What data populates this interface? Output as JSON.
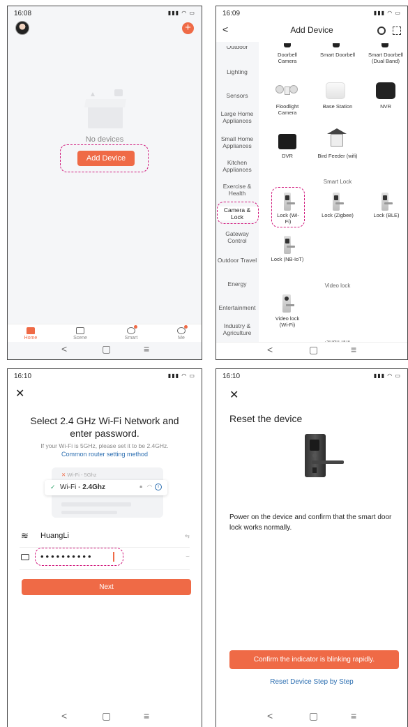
{
  "colors": {
    "accent": "#ef6a46",
    "link": "#2a6db0",
    "dash": "#d0147a"
  },
  "home": {
    "time": "16:08",
    "empty_text": "No devices",
    "add_device_label": "Add Device",
    "tabs": [
      {
        "label": "Home"
      },
      {
        "label": "Scene"
      },
      {
        "label": "Smart"
      },
      {
        "label": "Me"
      }
    ]
  },
  "add_device": {
    "time": "16:09",
    "title": "Add Device",
    "categories": [
      "Lighting",
      "Sensors",
      "Large Home Appliances",
      "Small Home Appliances",
      "Kitchen Appliances",
      "Exercise & Health",
      "Camera & Lock",
      "Gateway Control",
      "Outdoor Travel",
      "Energy",
      "Entertainment",
      "Industry & Agriculture"
    ],
    "top_cut_category": "Outdoor",
    "devices_row1": [
      "Doorbell Camera",
      "Smart Doorbell",
      "Smart Doorbell (Dual Band)"
    ],
    "devices_row2": [
      "Floodlight Camera",
      "Base Station",
      "NVR"
    ],
    "devices_row3": [
      "DVR",
      "Bird Feeder (wifi)"
    ],
    "section_smart_lock": "Smart Lock",
    "locks_row1": [
      "Lock (Wi-Fi)",
      "Lock (Zigbee)",
      "Lock (BLE)"
    ],
    "locks_row2": [
      "Lock (NB-IoT)"
    ],
    "section_video_lock": "Video lock",
    "video_locks": [
      "Video lock (Wi-Fi)"
    ],
    "section_smart_box": "Smart box"
  },
  "wifi": {
    "time": "16:10",
    "heading": "Select 2.4 GHz Wi-Fi Network and enter password.",
    "sub": "If your Wi-Fi is 5GHz, please set it to be 2.4GHz.",
    "link": "Common router setting method",
    "illus_5g": "Wi-Fi - 5Ghz",
    "illus_24_prefix": "Wi-Fi - ",
    "illus_24_bold": "2.4Ghz",
    "ssid": "HuangLi",
    "password": "••••••••••",
    "next_label": "Next"
  },
  "reset": {
    "time": "16:10",
    "title": "Reset the device",
    "desc": "Power on the device and confirm that the smart door lock works normally.",
    "confirm_label": "Confirm the indicator is blinking rapidly.",
    "step_link": "Reset Device Step by Step"
  }
}
